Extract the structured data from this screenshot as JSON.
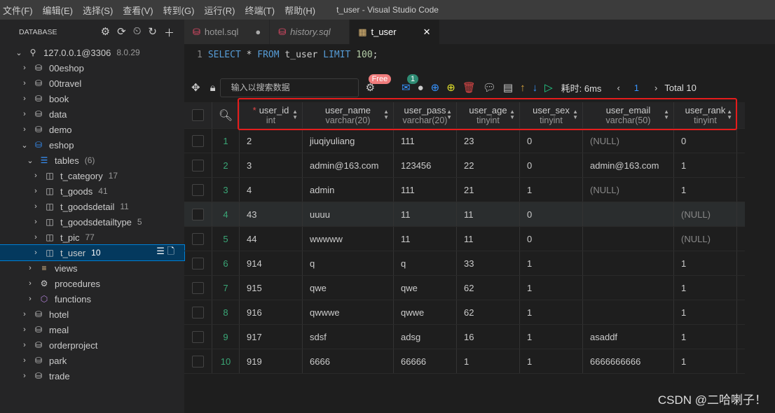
{
  "menu": [
    "文件(F)",
    "编辑(E)",
    "选择(S)",
    "查看(V)",
    "转到(G)",
    "运行(R)",
    "终端(T)",
    "帮助(H)"
  ],
  "window_title": "t_user - Visual Studio Code",
  "sidebar": {
    "title": "DATABASE",
    "connection": "127.0.0.1@3306",
    "version": "8.0.29",
    "dbs_before": [
      "00eshop",
      "00travel",
      "book",
      "data",
      "demo"
    ],
    "open_db": "eshop",
    "tables_label": "tables",
    "tables_count": "(6)",
    "tables": [
      {
        "name": "t_category",
        "count": "17"
      },
      {
        "name": "t_goods",
        "count": "41"
      },
      {
        "name": "t_goodsdetail",
        "count": "11"
      },
      {
        "name": "t_goodsdetailtype",
        "count": "5"
      },
      {
        "name": "t_pic",
        "count": "77"
      },
      {
        "name": "t_user",
        "count": "10"
      }
    ],
    "folders": [
      "views",
      "procedures",
      "functions"
    ],
    "dbs_after": [
      "hotel",
      "meal",
      "orderproject",
      "park",
      "trade"
    ]
  },
  "tabs": [
    {
      "label": "hotel.sql"
    },
    {
      "label": "history.sql"
    },
    {
      "label": "t_user"
    }
  ],
  "editor": {
    "line": "1",
    "kw1": "SELECT",
    "star": "*",
    "kw2": "FROM",
    "table": "t_user",
    "kw3": "LIMIT",
    "limit": "100",
    ";": ";"
  },
  "toolbar": {
    "search_placeholder": "输入以搜索数据",
    "free_badge": "Free",
    "mail_badge": "1",
    "timing": "耗时: 6ms",
    "page": "1",
    "total": "Total 10"
  },
  "columns": [
    {
      "name": "user_id",
      "type": "int",
      "pk": "*"
    },
    {
      "name": "user_name",
      "type": "varchar(20)"
    },
    {
      "name": "user_pass",
      "type": "varchar(20)"
    },
    {
      "name": "user_age",
      "type": "tinyint"
    },
    {
      "name": "user_sex",
      "type": "tinyint"
    },
    {
      "name": "user_email",
      "type": "varchar(50)"
    },
    {
      "name": "user_rank",
      "type": "tinyint"
    }
  ],
  "rows": [
    [
      "2",
      "jiuqiyuliang",
      "111",
      "23",
      "0",
      "(NULL)",
      "0"
    ],
    [
      "3",
      "admin@163.com",
      "123456",
      "22",
      "0",
      "admin@163.com",
      "1"
    ],
    [
      "4",
      "admin",
      "111",
      "21",
      "1",
      "(NULL)",
      "1"
    ],
    [
      "43",
      "uuuu",
      "11",
      "11",
      "0",
      "",
      "(NULL)"
    ],
    [
      "44",
      "wwwww",
      "11",
      "11",
      "0",
      "",
      "(NULL)"
    ],
    [
      "914",
      "q",
      "q",
      "33",
      "1",
      "",
      "1"
    ],
    [
      "915",
      "qwe",
      "qwe",
      "62",
      "1",
      "",
      "1"
    ],
    [
      "916",
      "qwwwe",
      "qwwe",
      "62",
      "1",
      "",
      "1"
    ],
    [
      "917",
      "sdsf",
      "adsg",
      "16",
      "1",
      "asaddf",
      "1"
    ],
    [
      "919",
      "6666",
      "66666",
      "1",
      "1",
      "6666666666",
      "1"
    ]
  ],
  "watermark": "CSDN @二哈喇子！"
}
